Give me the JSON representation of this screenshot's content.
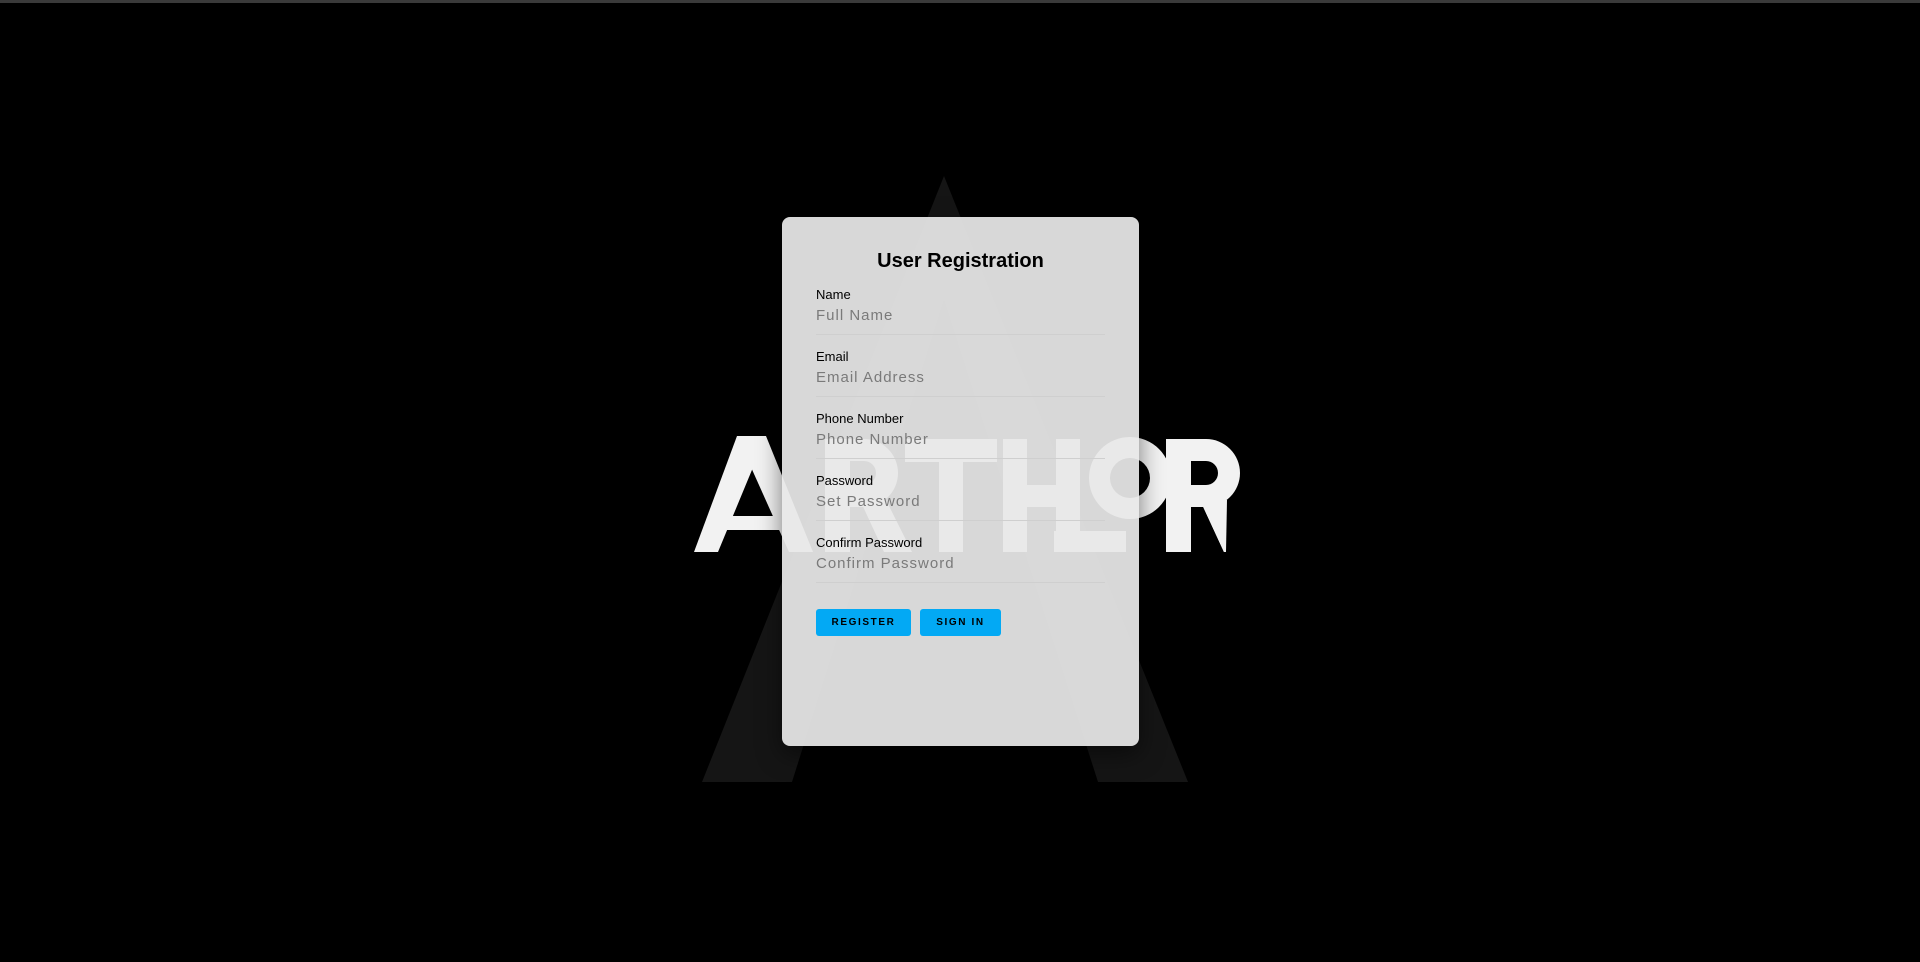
{
  "background": {
    "color": "#000000",
    "logo_text": "ARTHOR",
    "logo_color": "#f2f2f2"
  },
  "form": {
    "title": "User Registration",
    "fields": [
      {
        "label": "Name",
        "placeholder": "Full Name"
      },
      {
        "label": "Email",
        "placeholder": "Email Address"
      },
      {
        "label": "Phone Number",
        "placeholder": "Phone Number"
      },
      {
        "label": "Password",
        "placeholder": "Set Password"
      },
      {
        "label": "Confirm Password",
        "placeholder": "Confirm Password"
      }
    ],
    "buttons": {
      "register_label": "REGISTER",
      "signin_label": "SIGN IN",
      "accent_color": "#03a9f4"
    }
  }
}
